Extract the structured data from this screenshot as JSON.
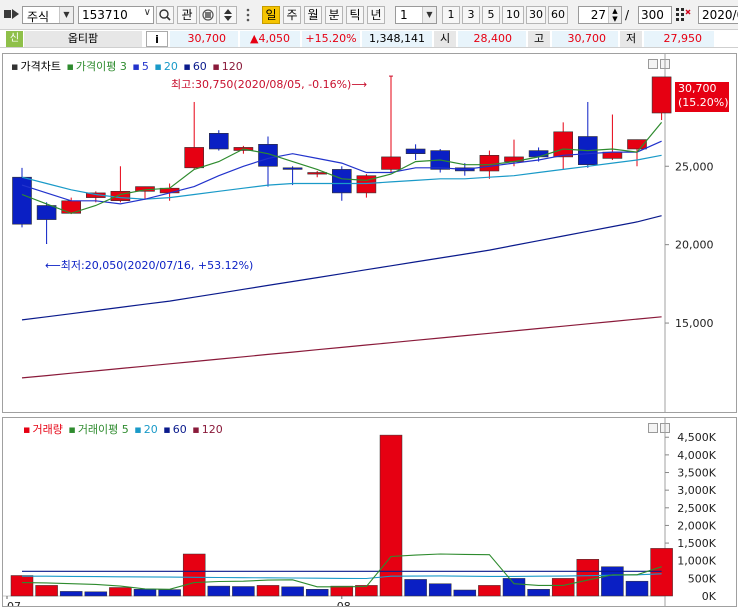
{
  "toolbar": {
    "market": "주식",
    "code": "153710",
    "btn_manage": "관",
    "periods": [
      "일",
      "주",
      "월",
      "분",
      "틱",
      "년"
    ],
    "active_period": "일",
    "unit_value": "1",
    "quick_counts": [
      "1",
      "3",
      "5",
      "10",
      "30",
      "60"
    ],
    "display_count": "27",
    "divider": "/",
    "total_count": "300",
    "date": "2020/0"
  },
  "infobar": {
    "badge": "신",
    "name": "옵티팜",
    "info_button": "i",
    "price": "30,700",
    "change": "▲4,050",
    "change_rate": "+15.20%",
    "volume": "1,348,141",
    "open_label": "시",
    "open": "28,400",
    "high_label": "고",
    "high": "30,700",
    "low_label": "저",
    "low": "27,950"
  },
  "colors": {
    "up": "#e60012",
    "down": "#0a1fc4",
    "ma3": "#2e8b2e",
    "ma5": "#2233cc",
    "ma20": "#1a9ac8",
    "ma60": "#0a1a8c",
    "ma120": "#8a1a3a"
  },
  "price_panel": {
    "legend": [
      {
        "text": "가격차트",
        "color": "#000000"
      },
      {
        "text": "가격이평 3",
        "color": "#2e8b2e"
      },
      {
        "text": "5",
        "color": "#2233cc"
      },
      {
        "text": "20",
        "color": "#1a9ac8"
      },
      {
        "text": "60",
        "color": "#0a1a8c"
      },
      {
        "text": "120",
        "color": "#8a1a3a"
      }
    ],
    "high_annotation": "최고:30,750(2020/08/05, -0.16%)⟶",
    "low_annotation": "⟵최저:20,050(2020/07/16, +53.12%)",
    "current_tag_price": "30,700",
    "current_tag_rate": "(15.20%)"
  },
  "volume_panel": {
    "legend": [
      {
        "text": "거래량",
        "color": "#e60012"
      },
      {
        "text": "거래이평 5",
        "color": "#2e8b2e"
      },
      {
        "text": "20",
        "color": "#1a9ac8"
      },
      {
        "text": "60",
        "color": "#0a1a8c"
      },
      {
        "text": "120",
        "color": "#8a1a3a"
      }
    ]
  },
  "chart_data": [
    {
      "type": "candlestick",
      "x_labels": [
        {
          "index": 0,
          "text": "07"
        },
        {
          "index": 13,
          "text": "08"
        }
      ],
      "yticks": [
        15000,
        20000,
        25000
      ],
      "ylim": [
        10500,
        32000
      ],
      "grid": false,
      "candles": [
        {
          "o": 24300,
          "h": 24900,
          "l": 21100,
          "c": 21300
        },
        {
          "o": 22500,
          "h": 22700,
          "l": 20050,
          "c": 21600
        },
        {
          "o": 22000,
          "h": 23000,
          "l": 21950,
          "c": 22800
        },
        {
          "o": 23000,
          "h": 23400,
          "l": 22700,
          "c": 23300
        },
        {
          "o": 22800,
          "h": 25000,
          "l": 22700,
          "c": 23400
        },
        {
          "o": 23400,
          "h": 23700,
          "l": 22900,
          "c": 23700
        },
        {
          "o": 23300,
          "h": 23900,
          "l": 22800,
          "c": 23600
        },
        {
          "o": 24900,
          "h": 29100,
          "l": 24800,
          "c": 26200
        },
        {
          "o": 27100,
          "h": 27300,
          "l": 26000,
          "c": 26100
        },
        {
          "o": 26000,
          "h": 26300,
          "l": 25800,
          "c": 26200
        },
        {
          "o": 26400,
          "h": 26900,
          "l": 23700,
          "c": 25000
        },
        {
          "o": 24900,
          "h": 25000,
          "l": 23800,
          "c": 24800
        },
        {
          "o": 24500,
          "h": 24700,
          "l": 24300,
          "c": 24600
        },
        {
          "o": 24800,
          "h": 25000,
          "l": 22800,
          "c": 23300
        },
        {
          "o": 23300,
          "h": 24500,
          "l": 23000,
          "c": 24400
        },
        {
          "o": 24800,
          "h": 30750,
          "l": 24600,
          "c": 25600
        },
        {
          "o": 26100,
          "h": 26400,
          "l": 25400,
          "c": 25800
        },
        {
          "o": 26000,
          "h": 26100,
          "l": 24600,
          "c": 24800
        },
        {
          "o": 24900,
          "h": 25200,
          "l": 24400,
          "c": 24700
        },
        {
          "o": 24700,
          "h": 26000,
          "l": 24200,
          "c": 25700
        },
        {
          "o": 25300,
          "h": 26700,
          "l": 25000,
          "c": 25600
        },
        {
          "o": 26000,
          "h": 26200,
          "l": 25300,
          "c": 25600
        },
        {
          "o": 25600,
          "h": 27800,
          "l": 24800,
          "c": 27200
        },
        {
          "o": 26900,
          "h": 29100,
          "l": 24900,
          "c": 25100
        },
        {
          "o": 25500,
          "h": 28300,
          "l": 25400,
          "c": 25900
        },
        {
          "o": 26100,
          "h": 26700,
          "l": 25000,
          "c": 26700
        },
        {
          "o": 28400,
          "h": 30700,
          "l": 27950,
          "c": 30700
        }
      ],
      "ma3": [
        23200,
        22600,
        22000,
        22500,
        23200,
        23500,
        23600,
        24800,
        25300,
        26100,
        25800,
        25300,
        24800,
        24200,
        24100,
        24500,
        25300,
        25400,
        25100,
        25100,
        25300,
        25600,
        26100,
        26000,
        26100,
        25900,
        27800
      ],
      "ma5": [
        23800,
        23300,
        22800,
        22800,
        22600,
        22900,
        23300,
        23700,
        24400,
        25000,
        25500,
        25800,
        25500,
        25200,
        24600,
        24600,
        24900,
        24900,
        24800,
        25000,
        25200,
        25400,
        25700,
        25800,
        25900,
        25900,
        26600
      ],
      "ma20": [
        24300,
        23900,
        23500,
        23200,
        23000,
        22900,
        23000,
        23200,
        23400,
        23600,
        23800,
        23900,
        23900,
        23900,
        23900,
        24000,
        24100,
        24200,
        24200,
        24300,
        24400,
        24600,
        24800,
        25000,
        25200,
        25400,
        25700
      ],
      "ma60": [
        15200,
        15400,
        15600,
        15800,
        16000,
        16200,
        16400,
        16650,
        16900,
        17150,
        17400,
        17650,
        17900,
        18150,
        18400,
        18650,
        18900,
        19150,
        19400,
        19650,
        19950,
        20250,
        20550,
        20850,
        21150,
        21450,
        21850
      ],
      "ma120": [
        11500,
        11650,
        11800,
        11950,
        12100,
        12250,
        12400,
        12550,
        12700,
        12850,
        13000,
        13150,
        13300,
        13450,
        13600,
        13750,
        13900,
        14050,
        14200,
        14350,
        14500,
        14650,
        14800,
        14950,
        15100,
        15250,
        15400
      ]
    },
    {
      "type": "bar",
      "yticks": [
        500,
        1000,
        1500,
        2000,
        2500,
        3000,
        3500,
        4000,
        4500
      ],
      "ytick_labels": [
        "500K",
        "1,000K",
        "1,500K",
        "2,000K",
        "2,500K",
        "3,000K",
        "3,500K",
        "4,000K",
        "4,500K"
      ],
      "zero_label": "0K",
      "ylim": [
        0,
        4700
      ],
      "unit": "K",
      "volumes": [
        580,
        300,
        130,
        120,
        240,
        190,
        180,
        1190,
        280,
        270,
        300,
        260,
        190,
        280,
        300,
        4560,
        470,
        350,
        170,
        300,
        500,
        190,
        500,
        1040,
        830,
        420,
        1350
      ],
      "up_flags": [
        true,
        true,
        false,
        false,
        true,
        false,
        false,
        true,
        false,
        false,
        true,
        false,
        false,
        true,
        true,
        true,
        false,
        false,
        false,
        true,
        false,
        false,
        true,
        true,
        false,
        false,
        true
      ],
      "vma5": [
        380,
        370,
        350,
        330,
        280,
        200,
        190,
        380,
        410,
        420,
        450,
        460,
        260,
        260,
        270,
        1120,
        1160,
        1190,
        1180,
        1170,
        350,
        300,
        300,
        450,
        600,
        600,
        830
      ],
      "vma20": [
        560,
        560,
        555,
        550,
        545,
        540,
        535,
        530,
        525,
        520,
        515,
        510,
        505,
        500,
        495,
        560,
        565,
        570,
        560,
        555,
        555,
        560,
        565,
        575,
        590,
        600,
        630
      ],
      "vma60": [
        700,
        700,
        700,
        700,
        700,
        700,
        700,
        700,
        700,
        700,
        700,
        700,
        700,
        700,
        700,
        700,
        700,
        700,
        700,
        700,
        700,
        700,
        700,
        700,
        700,
        700,
        700
      ]
    }
  ]
}
